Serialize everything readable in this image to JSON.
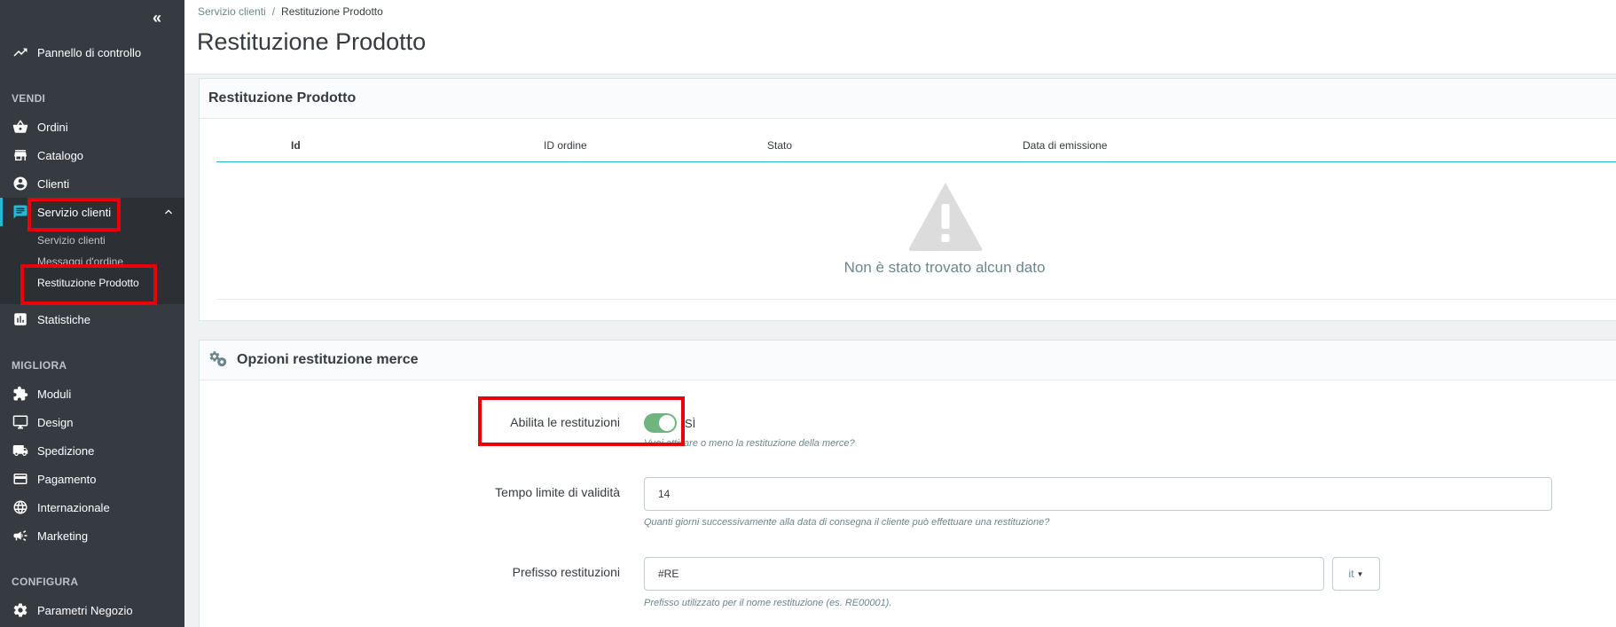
{
  "sidebar": {
    "collapse_glyph": "«",
    "dashboard": {
      "label": "Pannello di controllo",
      "icon": "trending-up-icon"
    },
    "sections": {
      "sell": "VENDI",
      "improve": "MIGLIORA",
      "configure": "CONFIGURA"
    },
    "items": {
      "orders": "Ordini",
      "catalog": "Catalogo",
      "customers": "Clienti",
      "customer_service": "Servizio clienti",
      "stats": "Statistiche",
      "modules": "Moduli",
      "design": "Design",
      "shipping": "Spedizione",
      "payment": "Pagamento",
      "international": "Internazionale",
      "marketing": "Marketing",
      "shop_params": "Parametri Negozio"
    },
    "submenu": [
      "Servizio clienti",
      "Messaggi d'ordine",
      "Restituzione Prodotto"
    ],
    "active_color": "#25b9d7"
  },
  "breadcrumb": {
    "parent": "Servizio clienti",
    "separator": "/",
    "current": "Restituzione Prodotto"
  },
  "page_title": "Restituzione Prodotto",
  "returns_panel": {
    "title": "Restituzione Prodotto",
    "columns": [
      "Id",
      "ID ordine",
      "Stato",
      "Data di emissione"
    ],
    "empty_message": "Non è stato trovato alcun dato"
  },
  "options_panel": {
    "title": "Opzioni restituzione merce",
    "enable": {
      "label": "Abilita le restituzioni",
      "state": "SÌ",
      "help": "Vuoi attivare o meno la restituzione della merce?"
    },
    "time_limit": {
      "label": "Tempo limite di validità",
      "value": "14",
      "help": "Quanti giorni successivamente alla data di consegna il cliente può effettuare una restituzione?"
    },
    "prefix": {
      "label": "Prefisso restituzioni",
      "value": "#RE",
      "lang": "it",
      "help": "Prefisso utilizzato per il nome restituzione (es. RE00001)."
    }
  },
  "colors": {
    "highlight": "#e8000b",
    "switch_on": "#70b580"
  }
}
